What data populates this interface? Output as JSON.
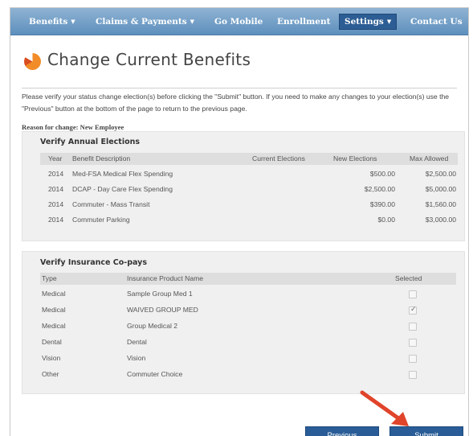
{
  "nav": {
    "items": [
      {
        "label": "Benefits",
        "dropdown": true
      },
      {
        "label": "Claims & Payments",
        "dropdown": true
      },
      {
        "label": "Go Mobile",
        "dropdown": false
      },
      {
        "label": "Enrollment",
        "dropdown": false
      },
      {
        "label": "Settings",
        "dropdown": true,
        "active": true
      },
      {
        "label": "Contact Us",
        "dropdown": false
      }
    ]
  },
  "page": {
    "title": "Change Current Benefits",
    "instructions": "Please verify your status change election(s) before clicking the \"Submit\" button. If you need to make any changes to your election(s) use the \"Previous\" button at the bottom of the page to return to the previous page.",
    "reason_label": "Reason for change:",
    "reason_value": "New Employee"
  },
  "annual_elections": {
    "title": "Verify Annual Elections",
    "headers": [
      "Year",
      "Benefit Description",
      "Current Elections",
      "New Elections",
      "Max Allowed"
    ],
    "rows": [
      {
        "year": "2014",
        "description": "Med-FSA Medical Flex Spending",
        "current": "",
        "new": "$500.00",
        "max": "$2,500.00"
      },
      {
        "year": "2014",
        "description": "DCAP - Day Care Flex Spending",
        "current": "",
        "new": "$2,500.00",
        "max": "$5,000.00"
      },
      {
        "year": "2014",
        "description": "Commuter - Mass Transit",
        "current": "",
        "new": "$390.00",
        "max": "$1,560.00"
      },
      {
        "year": "2014",
        "description": "Commuter Parking",
        "current": "",
        "new": "$0.00",
        "max": "$3,000.00"
      }
    ]
  },
  "insurance": {
    "title": "Verify Insurance Co-pays",
    "headers": [
      "Type",
      "Insurance Product Name",
      "Selected"
    ],
    "rows": [
      {
        "type": "Medical",
        "product": "Sample Group Med 1",
        "selected": false
      },
      {
        "type": "Medical",
        "product": "WAIVED GROUP MED",
        "selected": true
      },
      {
        "type": "Medical",
        "product": "Group Medical 2",
        "selected": false
      },
      {
        "type": "Dental",
        "product": "Dental",
        "selected": false
      },
      {
        "type": "Vision",
        "product": "Vision",
        "selected": false
      },
      {
        "type": "Other",
        "product": "Commuter Choice",
        "selected": false
      }
    ]
  },
  "buttons": {
    "previous": "Previous",
    "submit": "Submit"
  },
  "colors": {
    "nav_bg": "#6f9cc6",
    "nav_active": "#2c5d94",
    "button_bg": "#2a5d97",
    "arrow": "#e0442a",
    "logo_orange": "#f28c28"
  }
}
